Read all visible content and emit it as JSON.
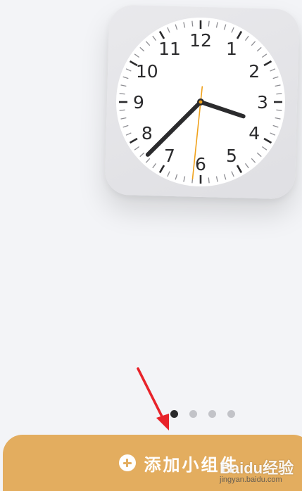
{
  "clock": {
    "numerals": [
      "12",
      "1",
      "2",
      "3",
      "4",
      "5",
      "6",
      "7",
      "8",
      "9",
      "10",
      "11"
    ],
    "time": {
      "hour": 3,
      "minute": 37,
      "second": 31
    },
    "face_color": "#ffffff",
    "hand_color": "#2b2b2d",
    "second_hand_color": "#f0a21b"
  },
  "pager": {
    "page_count": 4,
    "active_page": 1
  },
  "annotation": {
    "arrow_color": "#e8232a"
  },
  "action": {
    "add_widget_label": "添加小组件",
    "button_color": "#e3ad5f"
  },
  "watermark": {
    "brand": "Baidu经验",
    "url": "jingyan.baidu.com"
  }
}
